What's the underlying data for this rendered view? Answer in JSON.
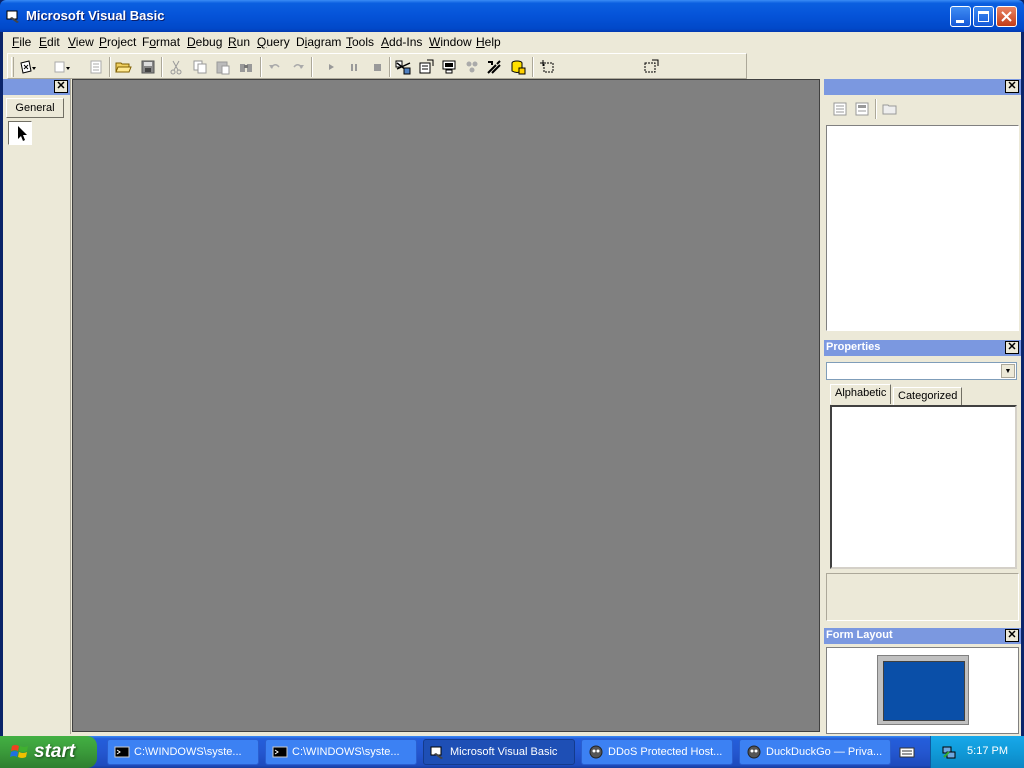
{
  "window": {
    "title": "Microsoft Visual Basic"
  },
  "menu": [
    "File",
    "Edit",
    "View",
    "Project",
    "Format",
    "Debug",
    "Run",
    "Query",
    "Diagram",
    "Tools",
    "Add-Ins",
    "Window",
    "Help"
  ],
  "menu_mnemonic_index": [
    0,
    0,
    0,
    0,
    1,
    0,
    0,
    0,
    1,
    0,
    0,
    0,
    0
  ],
  "toolbox": {
    "tab_label": "General",
    "tools": [
      "pointer-icon"
    ]
  },
  "panels": {
    "properties_title": "Properties",
    "properties_tabs": [
      "Alphabetic",
      "Categorized"
    ],
    "form_layout_title": "Form Layout"
  },
  "taskbar": {
    "start_label": "start",
    "tasks": [
      {
        "label": "C:\\WINDOWS\\syste...",
        "icon": "console-icon"
      },
      {
        "label": "C:\\WINDOWS\\syste...",
        "icon": "console-icon"
      },
      {
        "label": "Microsoft Visual Basic",
        "icon": "vb-icon",
        "active": true
      },
      {
        "label": "DDoS Protected Host...",
        "icon": "browser-icon"
      },
      {
        "label": "DuckDuckGo — Priva...",
        "icon": "browser-icon"
      }
    ],
    "clock": "5:17 PM"
  },
  "colors": {
    "titlebar": "#0553d8",
    "mdi_background": "#808080",
    "taskbar": "#245edb",
    "start_button": "#3a9a3a"
  }
}
